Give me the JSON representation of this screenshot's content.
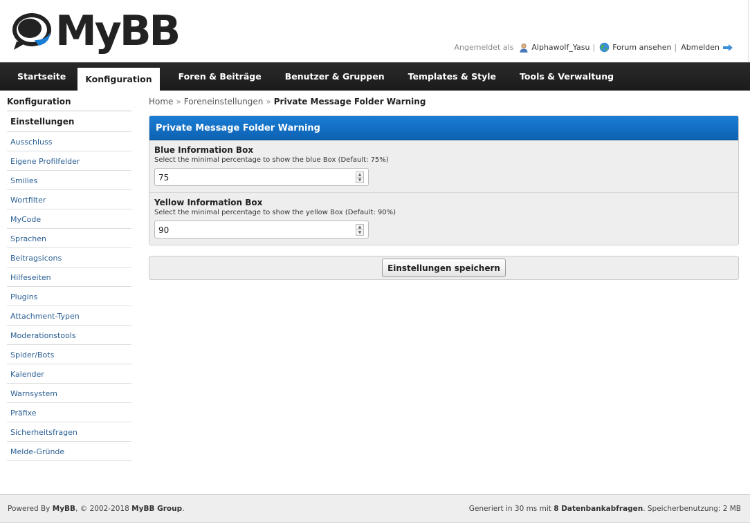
{
  "header": {
    "logo_text": "MyBB",
    "logged_in_label": "Angemeldet als",
    "username": "Alphawolf_Yasu",
    "view_forum": "Forum ansehen",
    "logout": "Abmelden",
    "separator": "|"
  },
  "nav": {
    "items": [
      {
        "label": "Startseite"
      },
      {
        "label": "Konfiguration"
      },
      {
        "label": "Foren & Beiträge"
      },
      {
        "label": "Benutzer & Gruppen"
      },
      {
        "label": "Templates & Style"
      },
      {
        "label": "Tools & Verwaltung"
      }
    ],
    "active_index": 1
  },
  "sidebar": {
    "title": "Konfiguration",
    "items": [
      {
        "label": "Einstellungen"
      },
      {
        "label": "Ausschluss"
      },
      {
        "label": "Eigene Profilfelder"
      },
      {
        "label": "Smilies"
      },
      {
        "label": "Wortfilter"
      },
      {
        "label": "MyCode"
      },
      {
        "label": "Sprachen"
      },
      {
        "label": "Beitragsicons"
      },
      {
        "label": "Hilfeseiten"
      },
      {
        "label": "Plugins"
      },
      {
        "label": "Attachment-Typen"
      },
      {
        "label": "Moderationstools"
      },
      {
        "label": "Spider/Bots"
      },
      {
        "label": "Kalender"
      },
      {
        "label": "Warnsystem"
      },
      {
        "label": "Präfixe"
      },
      {
        "label": "Sicherheitsfragen"
      },
      {
        "label": "Melde-Gründe"
      }
    ],
    "active_index": 0
  },
  "breadcrumb": {
    "home": "Home",
    "section": "Foreneinstellungen",
    "current": "Private Message Folder Warning",
    "separator": "»"
  },
  "panel": {
    "title": "Private Message Folder Warning",
    "settings": [
      {
        "label": "Blue Information Box",
        "description": "Select the minimal percentage to show the blue Box (Default: 75%)",
        "value": "75"
      },
      {
        "label": "Yellow Information Box",
        "description": "Select the minimal percentage to show the yellow Box (Default: 90%)",
        "value": "90"
      }
    ]
  },
  "save_button": "Einstellungen speichern",
  "footer": {
    "powered_by": "Powered By",
    "mybb": "MyBB",
    "copyright": ", © 2002-2018",
    "group": "MyBB Group",
    "period": ".",
    "generated_prefix": "Generiert in 30 ms mit",
    "queries": "8 Datenbankabfragen",
    "memory": ". Speicherbenutzung: 2 MB"
  },
  "colors": {
    "panel_head": "#0d62b3",
    "nav_bg": "#1b1b1b",
    "link": "#2a5f94"
  }
}
